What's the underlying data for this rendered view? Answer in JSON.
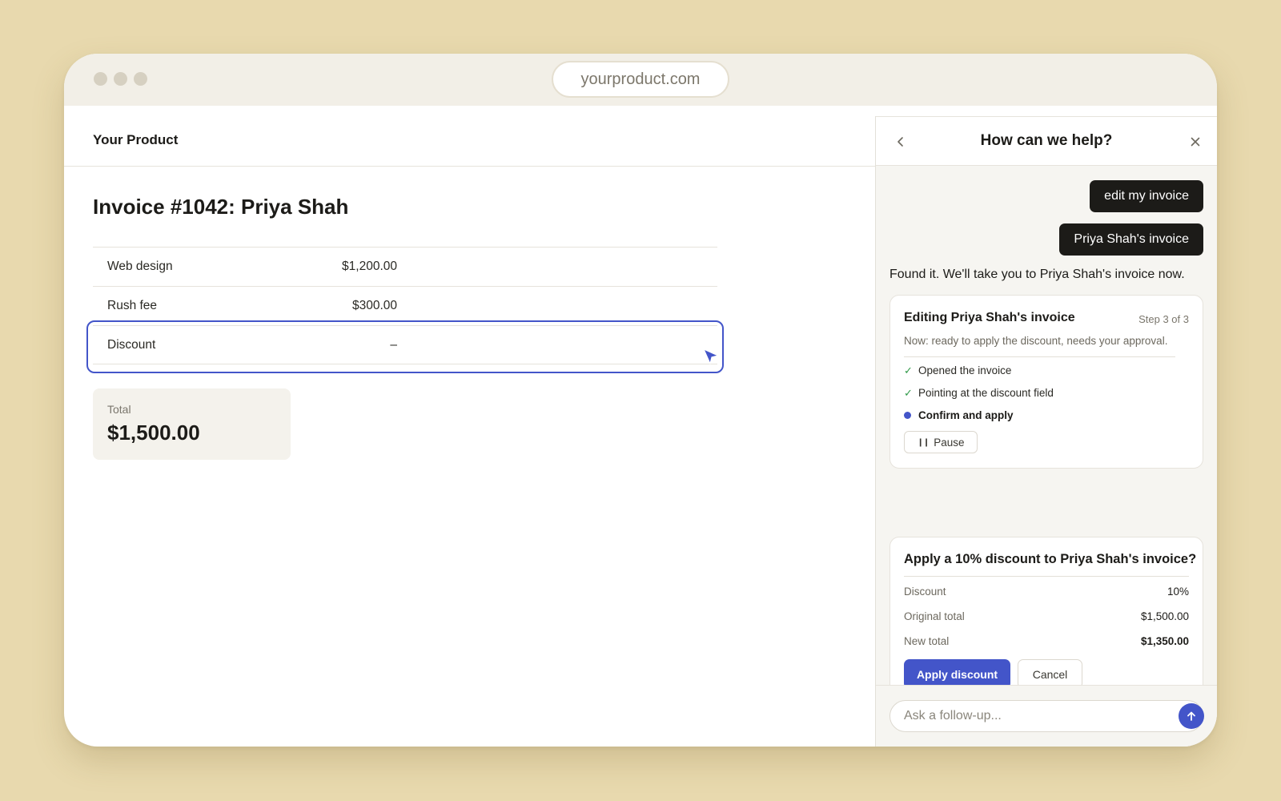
{
  "browser": {
    "url": "yourproduct.com"
  },
  "app": {
    "brand": "Your Product"
  },
  "invoice": {
    "title": "Invoice #1042: Priya Shah",
    "lines": [
      {
        "label": "Web design",
        "amount": "$1,200.00"
      },
      {
        "label": "Rush fee",
        "amount": "$300.00"
      },
      {
        "label": "Discount",
        "amount": "–"
      }
    ],
    "total_label": "Total",
    "total_value": "$1,500.00"
  },
  "help_panel": {
    "title": "How can we help?",
    "user_messages": [
      "edit my invoice",
      "Priya Shah's invoice"
    ],
    "assistant_reply": "Found it. We'll take you to Priya Shah's invoice now.",
    "progress_card": {
      "title": "Editing Priya Shah's invoice",
      "step_count": "Step 3 of 3",
      "status": "Now: ready to apply the discount, needs your approval.",
      "steps": [
        {
          "label": "Opened the invoice",
          "state": "done"
        },
        {
          "label": "Pointing at the discount field",
          "state": "done"
        },
        {
          "label": "Confirm and apply",
          "state": "active"
        }
      ],
      "pause_label": "Pause"
    },
    "confirm_card": {
      "title": "Apply a 10% discount to Priya Shah's invoice?",
      "rows": [
        {
          "label": "Discount",
          "value": "10%"
        },
        {
          "label": "Original total",
          "value": "$1,500.00"
        },
        {
          "label": "New total",
          "value": "$1,350.00"
        }
      ],
      "apply_label": "Apply discount",
      "cancel_label": "Cancel"
    },
    "composer": {
      "placeholder": "Ask a follow-up..."
    }
  },
  "colors": {
    "accent": "#4355c9",
    "background": "#e8d9ae",
    "check": "#2f9a48"
  },
  "icons": [
    "back-chevron-icon",
    "close-icon",
    "cursor-icon",
    "check-icon",
    "pause-icon",
    "send-arrow-icon"
  ]
}
